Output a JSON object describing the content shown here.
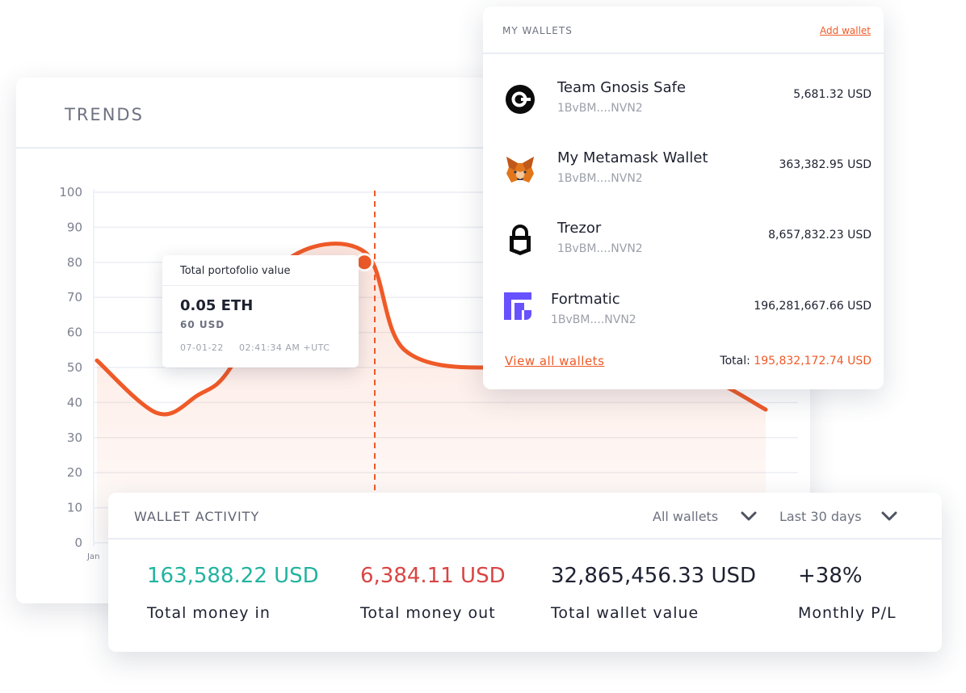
{
  "trends": {
    "title": "TRENDS",
    "y_ticks": [
      "100",
      "90",
      "80",
      "70",
      "60",
      "50",
      "40",
      "30",
      "20",
      "10",
      "0"
    ],
    "x_first_label": "Jan",
    "accent_color": "#ef5a28",
    "tooltip": {
      "heading": "Total portofolio value",
      "eth": "0.05 ETH",
      "usd": "60 USD",
      "date": "07-01-22",
      "time": "02:41:34 AM +UTC"
    }
  },
  "chart_data": {
    "type": "area",
    "ylim": [
      0,
      100
    ],
    "grid": true,
    "x": [
      0,
      0.09,
      0.15,
      0.2,
      0.28,
      0.4,
      0.46,
      0.6,
      0.75,
      0.9,
      1.0
    ],
    "y": [
      52,
      37,
      42,
      50,
      80,
      83,
      55,
      50,
      55,
      48,
      38
    ],
    "highlight": {
      "x": 0.4,
      "y": 80
    },
    "x_tick_labels": [
      "Jan"
    ]
  },
  "wallets": {
    "title": "MY WALLETS",
    "add_label": "Add wallet",
    "items": [
      {
        "name": "Team Gnosis Safe",
        "address": "1BvBM....NVN2",
        "amount": "5,681.32 USD",
        "icon": "gnosis-safe-icon"
      },
      {
        "name": "My Metamask Wallet",
        "address": "1BvBM....NVN2",
        "amount": "363,382.95 USD",
        "icon": "metamask-fox-icon"
      },
      {
        "name": "Trezor",
        "address": "1BvBM....NVN2",
        "amount": "8,657,832.23 USD",
        "icon": "trezor-lock-icon"
      },
      {
        "name": "Fortmatic",
        "address": "1BvBM....NVN2",
        "amount": "196,281,667.66 USD",
        "icon": "fortmatic-icon"
      }
    ],
    "view_all_label": "View all wallets",
    "total_label": "Total:",
    "total_value": "195,832,172.74 USD"
  },
  "activity": {
    "title": "WALLET ACTIVITY",
    "wallet_filter": "All wallets",
    "period_filter": "Last 30 days",
    "stats": [
      {
        "value": "163,588.22 USD",
        "label": "Total money in",
        "color": "#22b3a0"
      },
      {
        "value": "6,384.11 USD",
        "label": "Total money out",
        "color": "#d94545"
      },
      {
        "value": "32,865,456.33 USD",
        "label": "Total wallet value",
        "color": "#1d2130"
      },
      {
        "value": "+38%",
        "label": "Monthly P/L",
        "color": "#1d2130"
      }
    ]
  }
}
